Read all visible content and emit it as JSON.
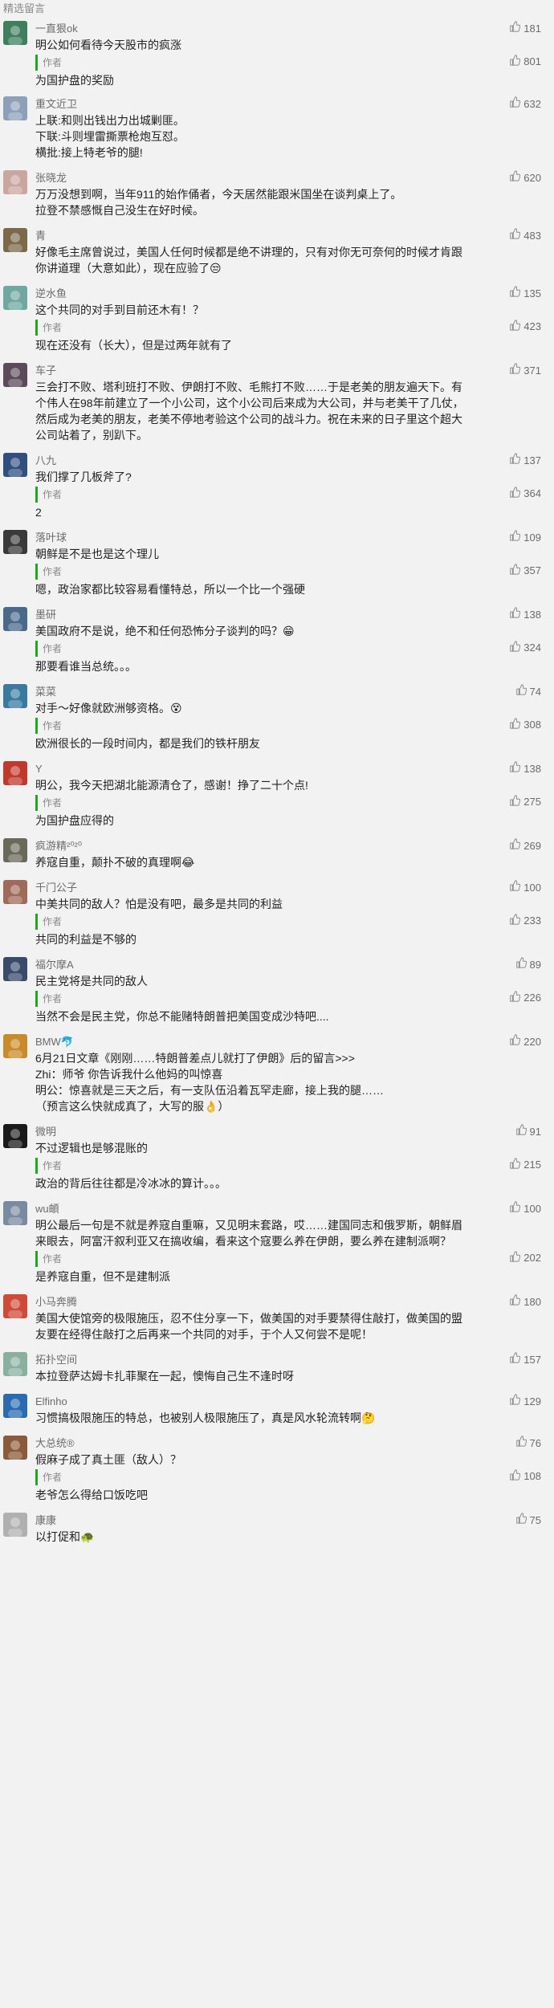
{
  "header": {
    "title": "精选留言"
  },
  "comments": [
    {
      "nick": "一直狠ok",
      "likes": "181",
      "text": [
        "明公如何看待今天股市的疯涨"
      ],
      "reply": {
        "tag": "作者",
        "likes": "801",
        "text": [
          "为国护盘的奖励"
        ]
      },
      "avatar": "#3f7f5f"
    },
    {
      "nick": "重文近卫",
      "likes": "632",
      "text": [
        "上联:和则出钱出力出城剿匪。",
        "下联:斗则埋雷撕票枪炮互怼。",
        "横批:接上特老爷的腿!"
      ],
      "avatar": "#8da0b8"
    },
    {
      "nick": "张晓龙",
      "likes": "620",
      "text": [
        "万万没想到啊，当年911的始作俑者，今天居然能跟米国坐在谈判桌上了。",
        "拉登不禁感慨自己没生在好时候。"
      ],
      "avatar": "#c9a7a0"
    },
    {
      "nick": "青",
      "likes": "483",
      "text": [
        "好像毛主席曾说过，美国人任何时候都是绝不讲理的，只有对你无可奈何的时候才肯跟",
        "你讲道理（大意如此），现在应验了😒"
      ],
      "avatar": "#7a6a4a"
    },
    {
      "nick": "逆水鱼",
      "likes": "135",
      "text": [
        "这个共同的对手到目前还木有！？"
      ],
      "reply": {
        "tag": "作者",
        "likes": "423",
        "text": [
          "现在还没有（长大），但是过两年就有了"
        ]
      },
      "avatar": "#6fa8a0"
    },
    {
      "nick": "车子",
      "likes": "371",
      "text": [
        "三会打不败、塔利班打不败、伊朗打不败、毛熊打不败……于是老美的朋友遍天下。有",
        "个伟人在98年前建立了一个小公司，这个小公司后来成为大公司，并与老美干了几仗，",
        "然后成为老美的朋友，老美不停地考验这个公司的战斗力。祝在未来的日子里这个超大",
        "公司站着了，别趴下。"
      ],
      "avatar": "#5a4a5a"
    },
    {
      "nick": "八九",
      "likes": "137",
      "text": [
        "我们撑了几板斧了?"
      ],
      "reply": {
        "tag": "作者",
        "likes": "364",
        "text": [
          "2"
        ]
      },
      "avatar": "#2f4f7f"
    },
    {
      "nick": "落叶球",
      "likes": "109",
      "text": [
        "朝鲜是不是也是这个理儿"
      ],
      "reply": {
        "tag": "作者",
        "likes": "357",
        "text": [
          "嗯，政治家都比较容易看懂特总，所以一个比一个强硬"
        ]
      },
      "avatar": "#3a3a3a"
    },
    {
      "nick": "墨研",
      "likes": "138",
      "text": [
        "美国政府不是说，绝不和任何恐怖分子谈判的吗？😁"
      ],
      "reply": {
        "tag": "作者",
        "likes": "324",
        "text": [
          "那要看谁当总统。。。"
        ]
      },
      "avatar": "#4a6a8a"
    },
    {
      "nick": "菜菜",
      "likes": "74",
      "text": [
        "对手～好像就欧洲够资格。😵"
      ],
      "reply": {
        "tag": "作者",
        "likes": "308",
        "text": [
          "欧洲很长的一段时间内，都是我们的铁杆朋友"
        ]
      },
      "avatar": "#3a7aa0"
    },
    {
      "nick": "Y",
      "likes": "138",
      "text": [
        "明公，我今天把湖北能源清仓了，感谢！挣了二十个点!"
      ],
      "reply": {
        "tag": "作者",
        "likes": "275",
        "text": [
          "为国护盘应得的"
        ]
      },
      "avatar": "#c0392b"
    },
    {
      "nick": "疯游精²⁰²⁰",
      "likes": "269",
      "text": [
        "养寇自重，颠扑不破的真理啊😂"
      ],
      "avatar": "#6a6a5a"
    },
    {
      "nick": "千门公子",
      "likes": "100",
      "text": [
        "中美共同的敌人？怕是没有吧，最多是共同的利益"
      ],
      "reply": {
        "tag": "作者",
        "likes": "233",
        "text": [
          "共同的利益是不够的"
        ]
      },
      "avatar": "#a06a5a"
    },
    {
      "nick": "福尔摩A",
      "likes": "89",
      "text": [
        "民主党将是共同的敌人"
      ],
      "reply": {
        "tag": "作者",
        "likes": "226",
        "text": [
          "当然不会是民主党，你总不能赌特朗普把美国变成沙特吧...."
        ]
      },
      "avatar": "#3a4a6a"
    },
    {
      "nick": "BMW🐬",
      "likes": "220",
      "text": [
        "6月21日文章《刚刚……特朗普差点儿就打了伊朗》后的留言>>>",
        "Zhi：师爷 你告诉我什么他妈的叫惊喜",
        "明公：惊喜就是三天之后，有一支队伍沿着瓦罕走廊，接上我的腿……",
        "（预言这么快就成真了，大写的服👌）"
      ],
      "avatar": "#c98a2a"
    },
    {
      "nick": "微明",
      "likes": "91",
      "text": [
        "不过逻辑也是够混账的"
      ],
      "reply": {
        "tag": "作者",
        "likes": "215",
        "text": [
          "政治的背后往往都是冷冰冰的算计。。。"
        ]
      },
      "avatar": "#1a1a1a"
    },
    {
      "nick": "wu頔",
      "likes": "100",
      "text": [
        "明公最后一句是不就是养寇自重嘛，又见明末套路，哎……建国同志和俄罗斯，朝鲜眉",
        "来眼去，阿富汗叙利亚又在搞收编，看来这个寇要么养在伊朗，要么养在建制派啊？"
      ],
      "reply": {
        "tag": "作者",
        "likes": "202",
        "text": [
          "是养寇自重，但不是建制派"
        ]
      },
      "avatar": "#7a8aa0"
    },
    {
      "nick": "小马奔腾",
      "likes": "180",
      "text": [
        "美国大使馆旁的极限施压，忍不住分享一下，做美国的对手要禁得住敲打，做美国的盟",
        "友要在经得住敲打之后再来一个共同的对手，于个人又何尝不是呢！"
      ],
      "avatar": "#d04a3a"
    },
    {
      "nick": "拓扑空间",
      "likes": "157",
      "text": [
        "本拉登萨达姆卡扎菲聚在一起，懊悔自己生不逢时呀"
      ],
      "avatar": "#8ab0a0"
    },
    {
      "nick": "Elfinho",
      "likes": "129",
      "text": [
        "习惯搞极限施压的特总，也被别人极限施压了，真是风水轮流转啊🤔"
      ],
      "avatar": "#2a6ab0"
    },
    {
      "nick": "大总统®",
      "likes": "76",
      "text": [
        "假麻子成了真土匪（敌人）？"
      ],
      "reply": {
        "tag": "作者",
        "likes": "108",
        "text": [
          "老爷怎么得给口饭吃吧"
        ]
      },
      "avatar": "#8a5a3a"
    },
    {
      "nick": "康康",
      "likes": "75",
      "text": [
        "以打促和🐢"
      ],
      "avatar": "#b0b0b0"
    }
  ]
}
